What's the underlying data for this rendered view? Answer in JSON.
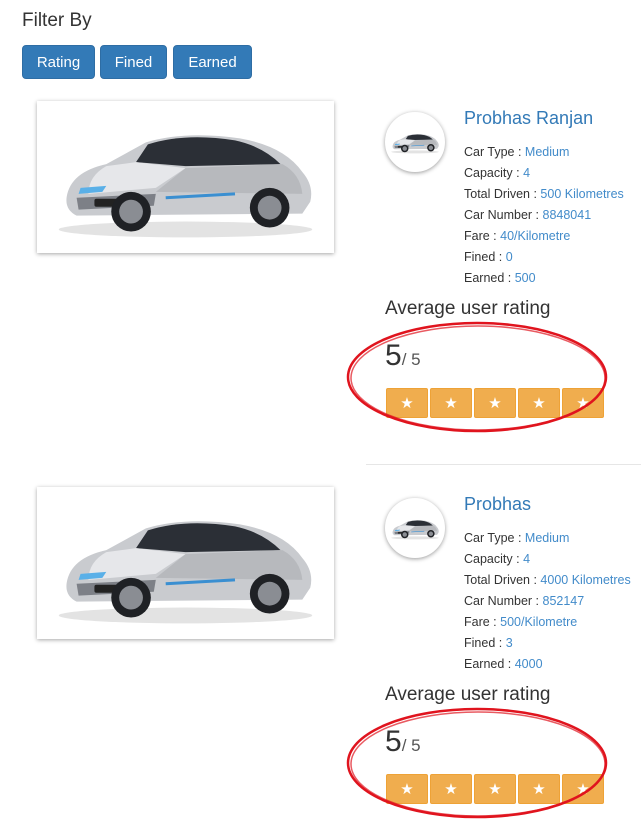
{
  "filter": {
    "title": "Filter By",
    "buttons": [
      "Rating",
      "Fined",
      "Earned"
    ]
  },
  "cards": [
    {
      "name": "Probhas Ranjan",
      "fields": [
        {
          "label": "Car Type",
          "value": "Medium"
        },
        {
          "label": "Capacity",
          "value": "4"
        },
        {
          "label": "Total Driven",
          "value": "500 Kilometres"
        },
        {
          "label": "Car Number",
          "value": "8848041"
        },
        {
          "label": "Fare",
          "value": "40/Kilometre"
        },
        {
          "label": "Fined",
          "value": "0"
        },
        {
          "label": "Earned",
          "value": "500"
        }
      ],
      "rating_title": "Average user rating",
      "rating": "5",
      "rating_max": "/ 5",
      "stars": 5
    },
    {
      "name": "Probhas",
      "fields": [
        {
          "label": "Car Type",
          "value": "Medium"
        },
        {
          "label": "Capacity",
          "value": "4"
        },
        {
          "label": "Total Driven",
          "value": "4000 Kilometres"
        },
        {
          "label": "Car Number",
          "value": "852147"
        },
        {
          "label": "Fare",
          "value": "500/Kilometre"
        },
        {
          "label": "Fined",
          "value": "3"
        },
        {
          "label": "Earned",
          "value": "4000"
        }
      ],
      "rating_title": "Average user rating",
      "rating": "5",
      "rating_max": "/ 5",
      "stars": 5
    }
  ],
  "colors": {
    "primary_button": "#337ab7",
    "link": "#337ab7",
    "star": "#f0ad4e",
    "annotation": "#e0141e"
  },
  "icons": {
    "star": "★"
  }
}
